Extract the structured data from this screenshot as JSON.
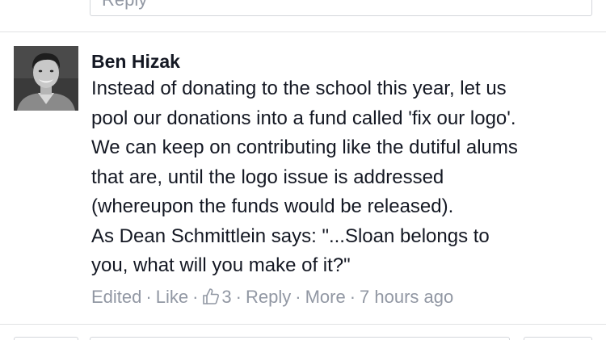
{
  "previous_reply": {
    "label": "Reply"
  },
  "comment": {
    "author": "Ben Hizak",
    "body_lines": [
      "Instead of donating to the school this year, let us",
      "pool our donations into a fund called 'fix our logo'.",
      "We can keep on contributing like the dutiful alums",
      "that are, until the logo issue is addressed",
      "(whereupon the funds would be released).",
      "As Dean Schmittlein says: \"...Sloan belongs to",
      "you, what will you make of it?\""
    ],
    "actions": {
      "edited": "Edited",
      "like": "Like",
      "like_count": "3",
      "reply": "Reply",
      "more": "More",
      "timestamp": "7 hours ago",
      "separator": "·"
    },
    "like_count_icon": "thumbs-up-icon"
  },
  "colors": {
    "text": "#141823",
    "meta": "#9197a3",
    "border": "#d3d6db"
  }
}
